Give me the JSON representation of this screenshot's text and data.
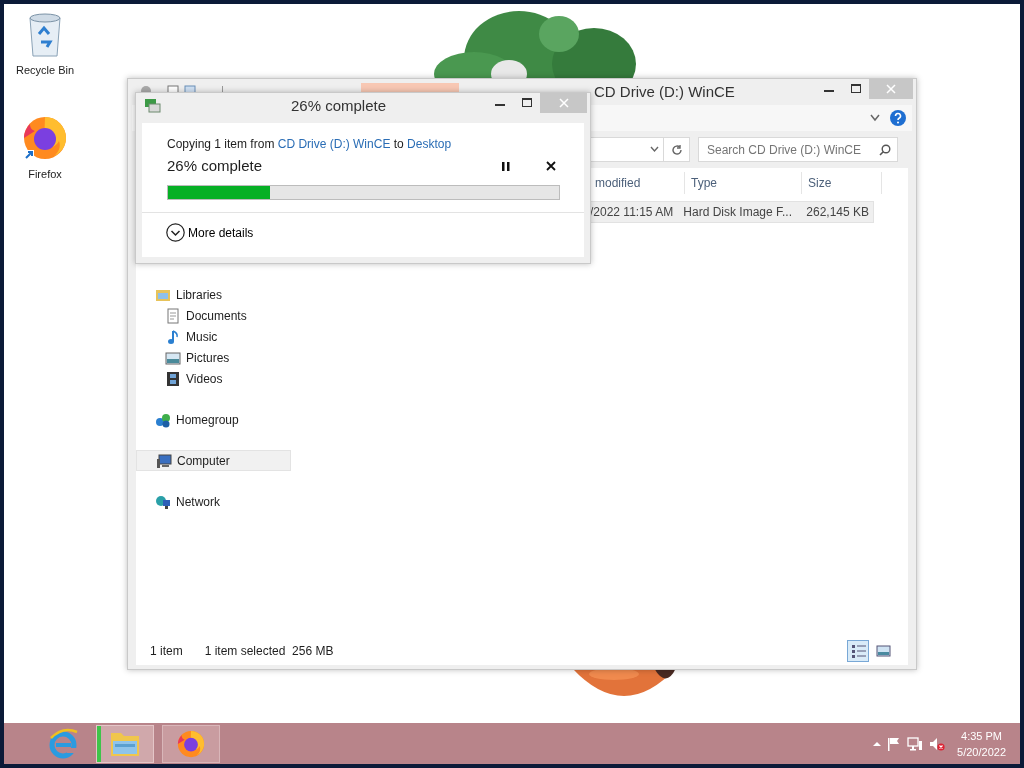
{
  "desktop_icons": [
    {
      "label": "Recycle Bin",
      "kind": "recycle"
    },
    {
      "label": "Firefox",
      "kind": "firefox"
    }
  ],
  "explorer": {
    "title": "CD Drive (D:) WinCE",
    "search": {
      "placeholder": "Search CD Drive (D:) WinCE"
    },
    "columns": [
      "modified",
      "Type",
      "Size"
    ],
    "rows": [
      {
        "cells": [
          "/2022 11:15 AM",
          "Hard Disk Image F...",
          "262,145 KB"
        ],
        "selected": true
      }
    ],
    "nav": [
      {
        "label": "Libraries",
        "kind": "libraries",
        "selected": false,
        "children": [
          {
            "label": "Documents",
            "kind": "documents",
            "selected": false
          },
          {
            "label": "Music",
            "kind": "music",
            "selected": false
          },
          {
            "label": "Pictures",
            "kind": "pictures",
            "selected": false
          },
          {
            "label": "Videos",
            "kind": "videos",
            "selected": false
          }
        ]
      },
      {
        "label": "Homegroup",
        "kind": "homegroup",
        "selected": false
      },
      {
        "label": "Computer",
        "kind": "computer",
        "selected": true
      },
      {
        "label": "Network",
        "kind": "network",
        "selected": false
      }
    ],
    "status": {
      "count": "1 item",
      "selection": "1 item selected  256 MB"
    },
    "views": [
      {
        "kind": "details",
        "selected": true
      },
      {
        "kind": "large",
        "selected": false
      }
    ]
  },
  "copy_dialog": {
    "title": "26% complete",
    "prefix": "Copying 1 item from",
    "source": "CD Drive (D:) WinCE",
    "middle": "to",
    "destination": "Desktop",
    "progress_text": "26% complete",
    "level": 0.26,
    "details": "More details"
  },
  "taskbar": {
    "items": [
      {
        "kind": "ie",
        "selected": false,
        "running": false
      },
      {
        "kind": "explorer",
        "selected": true,
        "running": true
      },
      {
        "kind": "firefox",
        "selected": false,
        "running": true
      }
    ],
    "time": "4:35 PM",
    "date": "5/20/2022"
  }
}
